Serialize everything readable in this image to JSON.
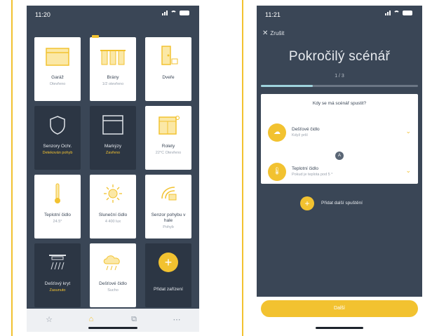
{
  "phone1": {
    "status_time": "11:20",
    "tiles": [
      {
        "name": "Garáž",
        "status": "Otevřeno",
        "theme": "light",
        "icon": "garage-icon"
      },
      {
        "name": "Brány",
        "status": "1/2 otevřeno",
        "theme": "light",
        "icon": "gate-icon"
      },
      {
        "name": "Dveře",
        "status": "",
        "theme": "light",
        "icon": "door-lock-icon"
      },
      {
        "name": "Senzory Ochr.",
        "status": "Detekován pohyb",
        "theme": "dark",
        "icon": "shield-icon"
      },
      {
        "name": "Markýzy",
        "status": "Zavřeno",
        "theme": "dark",
        "icon": "awning-icon"
      },
      {
        "name": "Rolety",
        "status": "22°C Otevřeno",
        "theme": "light",
        "icon": "window-blind-icon"
      },
      {
        "name": "Teplotní čidlo",
        "status": "24.5°",
        "theme": "light",
        "icon": "thermometer-icon"
      },
      {
        "name": "Sluneční čidlo",
        "status": "4 400 lux",
        "theme": "light",
        "icon": "sun-icon"
      },
      {
        "name": "Senzor pohybu v hale",
        "status": "Pohyb",
        "theme": "light",
        "icon": "motion-sensor-icon"
      },
      {
        "name": "Dešťový kryt",
        "status": "Zasunuto",
        "theme": "dark",
        "icon": "rain-cover-icon"
      },
      {
        "name": "Dešťové čidlo",
        "status": "Sucho",
        "theme": "light",
        "icon": "rain-cloud-icon"
      },
      {
        "name": "Přidat zařízení",
        "status": "",
        "theme": "dark",
        "icon": "plus-icon"
      }
    ],
    "tabbar": [
      "star-icon",
      "home-icon",
      "scenes-icon",
      "more-icon"
    ]
  },
  "phone2": {
    "status_time": "11:21",
    "back_label": "Zrušit",
    "title": "Pokročilý scénář",
    "step": "1 / 3",
    "progress": 0.33,
    "question": "Kdy se má scénář spustit?",
    "conditions": [
      {
        "name": "Dešťové čidlo",
        "desc": "Když prší",
        "icon": "rain-cloud-icon"
      },
      {
        "name": "Teplotní čidlo",
        "desc": "Pokud je teplota pod 5 °",
        "icon": "thermometer-icon"
      }
    ],
    "and_label": "A",
    "add_label": "Přidat další spuštění",
    "next_label": "Další"
  },
  "colors": {
    "accent": "#f2c230",
    "background": "#3a4656",
    "tile_dark": "#2c3644"
  }
}
